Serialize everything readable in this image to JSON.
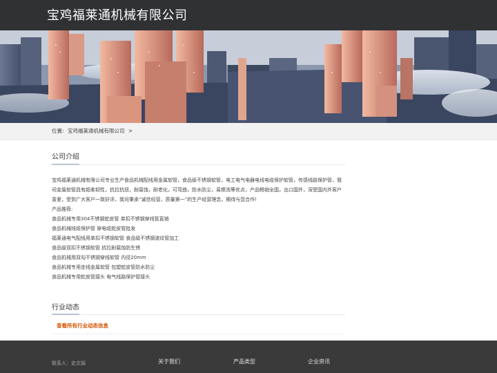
{
  "header": {
    "site_title": "宝鸡福莱通机械有限公司"
  },
  "breadcrumb": {
    "prefix": "位置:",
    "current": "宝鸡福莱通机械有限公司",
    "separator": ">"
  },
  "about": {
    "title": "公司介绍",
    "paragraph_lines": [
      "宝鸡福莱通机械有限公司专业生产食品机械配线用金属软管，食品级不锈钢软管，电工电气电器电线电缆保护软管，传感线路保护管，我",
      "司金属软管具有超柔韧性，抗拉抗扭，耐腐蚀，耐老化，可弯曲，防水防尘，易擦洗等优点，产品畅销全国，出口国外，深受国内外客户",
      "喜爱，受到广大客户一致好评，我司秉承“诚信经营，质量第一”的生产经营理念，期待与您合作!"
    ],
    "products_heading": "产品推荐:",
    "products": [
      "食品机械专用304不锈钢蛇皮管 单扣不锈钢穿线管直销",
      "食品机械线缆保护管 穿电缆蛇皮管批发",
      "福莱通电气配线用单扣不锈钢软管 食品级不锈钢波纹管加工",
      "食品级双扣不锈钢软管 抗拉耐腐蚀防生锈",
      "食品机械用双勾不锈钢穿线软管 内径20mm",
      "食品机械专用走线金属软管 包塑蛇皮管防水防尘",
      "食品机械专用蛇皮管接头 电气线路保护管接头"
    ]
  },
  "news": {
    "title": "行业动态",
    "link_label": "查看所有行业动态信息"
  },
  "footer": {
    "contact": "联系人：史文娟",
    "columns": [
      "关于我们",
      "产品类型",
      "企业资讯"
    ]
  },
  "colors": {
    "header_bg": "#2f3133",
    "footer_bg": "#3a3a3a",
    "link_accent": "#d35400"
  }
}
